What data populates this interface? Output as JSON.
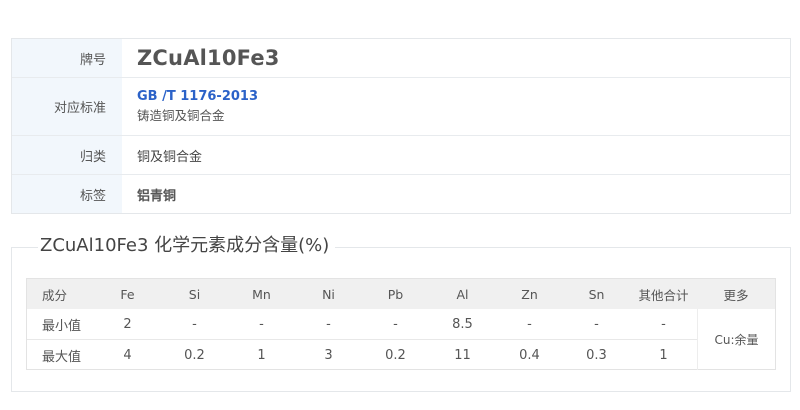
{
  "info": {
    "grade_label": "牌号",
    "grade_value": "ZCuAl10Fe3",
    "standard_label": "对应标准",
    "standard_link": "GB /T 1176-2013",
    "standard_desc": "铸造铜及铜合金",
    "category_label": "归类",
    "category_value": "铜及铜合金",
    "tag_label": "标签",
    "tag_value": "铝青铜"
  },
  "composition": {
    "title": "ZCuAl10Fe3 化学元素成分含量(%)",
    "headers": [
      "成分",
      "Fe",
      "Si",
      "Mn",
      "Ni",
      "Pb",
      "Al",
      "Zn",
      "Sn",
      "其他合计",
      "更多"
    ],
    "rows": [
      {
        "label": "最小值",
        "values": [
          "2",
          "-",
          "-",
          "-",
          "-",
          "8.5",
          "-",
          "-",
          "-"
        ]
      },
      {
        "label": "最大值",
        "values": [
          "4",
          "0.2",
          "1",
          "3",
          "0.2",
          "11",
          "0.4",
          "0.3",
          "1"
        ]
      }
    ],
    "more_value": "Cu:余量"
  }
}
